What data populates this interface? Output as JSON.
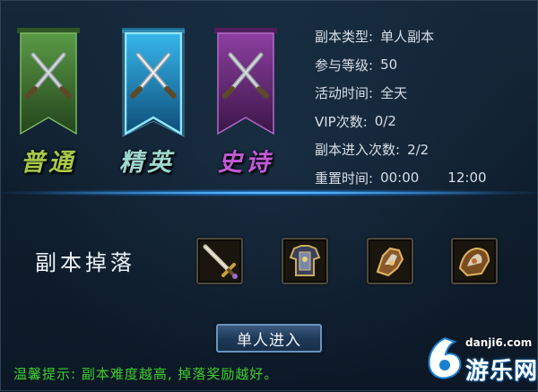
{
  "difficulty_tabs": [
    {
      "label": "普通",
      "color": "#4e8a3a"
    },
    {
      "label": "精英",
      "color": "#1e9ed8"
    },
    {
      "label": "史诗",
      "color": "#7a2f8c"
    }
  ],
  "info": {
    "type_label": "副本类型:",
    "type_value": "单人副本",
    "level_label": "参与等级:",
    "level_value": "50",
    "time_label": "活动时间:",
    "time_value": "全天",
    "vip_label": "VIP次数:",
    "vip_value": "0/2",
    "entries_label": "副本进入次数:",
    "entries_value": "2/2",
    "reset_label": "重置时间:",
    "reset_value_1": "00:00",
    "reset_value_2": "12:00"
  },
  "drops": {
    "label": "副本掉落",
    "items": [
      {
        "icon": "sword-item-icon"
      },
      {
        "icon": "armor-item-icon"
      },
      {
        "icon": "gauntlet-item-icon"
      },
      {
        "icon": "shoulder-item-icon"
      }
    ]
  },
  "enter_button": "单人进入",
  "tip": "温馨提示: 副本难度越高, 掉落奖励越好。",
  "watermark": {
    "url": "danji6.com",
    "name": "游乐网"
  }
}
